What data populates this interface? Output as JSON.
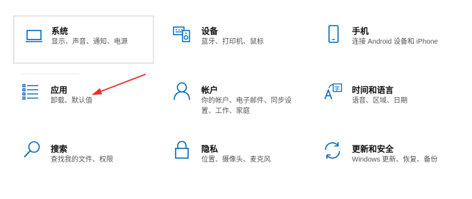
{
  "tiles": [
    {
      "title": "系统",
      "desc": "显示、声音、通知、电源",
      "icon": "laptop-icon"
    },
    {
      "title": "设备",
      "desc": "蓝牙、打印机、鼠标",
      "icon": "keyboard-speaker-icon"
    },
    {
      "title": "手机",
      "desc": "连接 Android 设备和 iPhone",
      "icon": "phone-icon"
    },
    {
      "title": "应用",
      "desc": "卸载、默认值",
      "icon": "apps-list-icon"
    },
    {
      "title": "帐户",
      "desc": "你的帐户、电子邮件、同步设\n置、工作、家庭",
      "icon": "person-icon"
    },
    {
      "title": "时间和语言",
      "desc": "语音、区域、日期",
      "icon": "time-language-icon"
    },
    {
      "title": "搜索",
      "desc": "查找我的文件、权限",
      "icon": "search-icon"
    },
    {
      "title": "隐私",
      "desc": "位置、摄像头、麦克风",
      "icon": "lock-icon"
    },
    {
      "title": "更新和安全",
      "desc": "Windows 更新、恢复、备份",
      "icon": "refresh-icon"
    }
  ],
  "colors": {
    "accent": "#0067c0",
    "arrow": "#e5322d"
  }
}
